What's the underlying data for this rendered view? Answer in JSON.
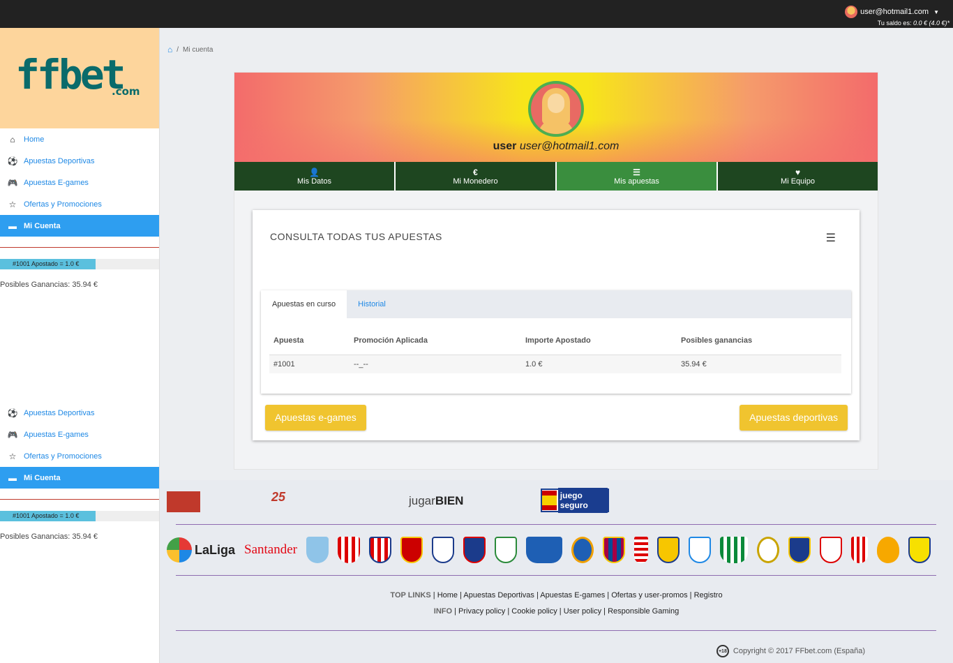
{
  "header": {
    "user_label": "user@hotmail1.com",
    "balance_label": "Tu saldo es:",
    "balance_value": "0.0 € (4.0 €)*"
  },
  "logo": {
    "main": "ffbet",
    "suffix": ".com"
  },
  "sidebar": {
    "items": [
      {
        "label": "Home",
        "icon": "home-icon"
      },
      {
        "label": "Apuestas Deportivas",
        "icon": "soccer-ball-icon"
      },
      {
        "label": "Apuestas E-games",
        "icon": "gamepad-icon"
      },
      {
        "label": "Ofertas y Promociones",
        "icon": "star-icon"
      },
      {
        "label": "Mi Cuenta",
        "icon": "id-card-icon"
      }
    ],
    "bet_slip": "#1001 Apostado = 1.0 €",
    "possible_gains": "Posibles Ganancias: 35.94 €"
  },
  "breadcrumb": {
    "current": "Mi cuenta"
  },
  "profile": {
    "name": "user",
    "email": "user@hotmail1.com"
  },
  "tabs": [
    {
      "label": "Mis Datos",
      "icon": "user-icon"
    },
    {
      "label": "Mi Monedero",
      "icon": "euro-icon"
    },
    {
      "label": "Mis apuestas",
      "icon": "list-icon"
    },
    {
      "label": "Mi Equipo",
      "icon": "heart-icon"
    }
  ],
  "card": {
    "title": "CONSULTA TODAS TUS APUESTAS",
    "inner_tabs": [
      "Apuestas en curso",
      "Historial"
    ],
    "columns": [
      "Apuesta",
      "Promoción Aplicada",
      "Importe Apostado",
      "Posibles ganancias"
    ],
    "rows": [
      [
        "#1001",
        "--_--",
        "1.0 €",
        "35.94 €"
      ]
    ],
    "btn_egames": "Apuestas e-games",
    "btn_sports": "Apuestas deportivas"
  },
  "footer": {
    "partner_jugar": "jugar",
    "partner_bien": "BIEN",
    "partner_seguro": "juego seguro",
    "laliga": "LaLiga",
    "santander": "Santander",
    "top_links_label": "TOP LINKS",
    "top_links": [
      "Home",
      "Apuestas Deportivas",
      "Apuestas E-games",
      "Ofertas y user-promos",
      "Registro"
    ],
    "info_label": "INFO",
    "info_links": [
      "Privacy policy",
      "Cookie policy",
      "User policy",
      "Responsible Gaming"
    ],
    "age": "+18",
    "copyright": "Copyright © 2017 FFbet.com (España)"
  }
}
